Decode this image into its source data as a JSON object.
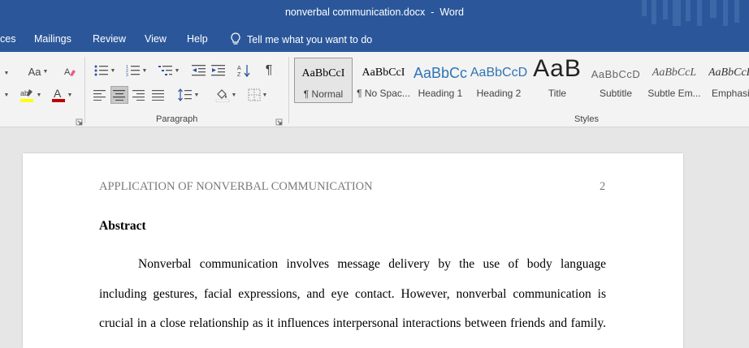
{
  "window": {
    "title": "nonverbal communication.docx  -  Word"
  },
  "tabs": [
    "ces",
    "Mailings",
    "Review",
    "View",
    "Help"
  ],
  "tell_me": "Tell me what you want to do",
  "ribbon": {
    "font": {
      "aa_label": "Aa"
    },
    "paragraph": {
      "label": "Paragraph",
      "pilcrow": "¶"
    },
    "styles": {
      "label": "Styles",
      "items": [
        {
          "preview": "AaBbCcI",
          "name": "¶ Normal"
        },
        {
          "preview": "AaBbCcI",
          "name": "¶ No Spac..."
        },
        {
          "preview": "AaBbCc",
          "name": "Heading 1"
        },
        {
          "preview": "AaBbCcD",
          "name": "Heading 2"
        },
        {
          "preview": "AaB",
          "name": "Title"
        },
        {
          "preview": "AaBbCcD",
          "name": "Subtitle"
        },
        {
          "preview": "AaBbCcL",
          "name": "Subtle Em..."
        },
        {
          "preview": "AaBbCcL",
          "name": "Emphasis"
        }
      ]
    }
  },
  "colors": {
    "accent": "#2b579a",
    "font_color": "#c00000",
    "highlight": "#ffff00"
  },
  "document": {
    "header": "APPLICATION OF NONVERBAL COMMUNICATION",
    "page_number": "2",
    "heading": "Abstract",
    "lines": [
      "Nonverbal communication involves message delivery by the use of body language",
      "including gestures, facial expressions, and eye contact. However, nonverbal communication is",
      "crucial in a close relationship as it influences interpersonal interactions between friends and family."
    ]
  }
}
